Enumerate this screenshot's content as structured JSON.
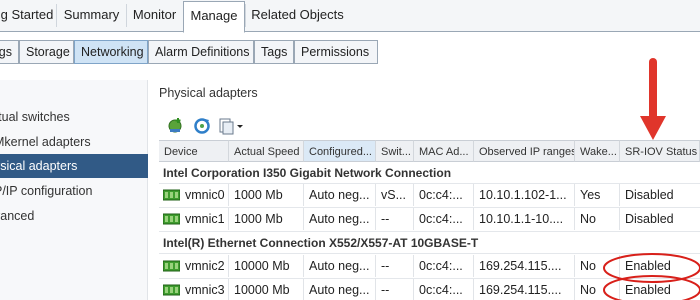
{
  "top_tabs": [
    "g Started",
    "Summary",
    "Monitor",
    "Manage",
    "Related Objects"
  ],
  "sub_tabs": [
    "ings",
    "Storage",
    "Networking",
    "Alarm Definitions",
    "Tags",
    "Permissions"
  ],
  "left_nav": [
    "rtual switches",
    "Mkernel adapters",
    "ysical adapters",
    "P/IP configuration",
    "vanced"
  ],
  "section_title": "Physical adapters",
  "toolbar": {
    "icons": [
      "add-networking-icon",
      "refresh-icon",
      "actions-menu-icon"
    ]
  },
  "grid": {
    "columns": [
      "Device",
      "Actual Speed",
      "Configured...",
      "Swit...",
      "MAC Ad...",
      "Observed IP ranges",
      "Wake...",
      "SR-IOV Status"
    ],
    "groups": [
      {
        "name": "Intel Corporation I350 Gigabit Network Connection",
        "rows": [
          [
            "vmnic0",
            "1000 Mb",
            "Auto neg...",
            "vS...",
            "0c:c4:...",
            "10.10.1.102-1...",
            "Yes",
            "Disabled"
          ],
          [
            "vmnic1",
            "1000 Mb",
            "Auto neg...",
            "--",
            "0c:c4:...",
            "10.10.1.1-10....",
            "No",
            "Disabled"
          ]
        ]
      },
      {
        "name": "Intel(R) Ethernet Connection X552/X557-AT 10GBASE-T",
        "rows": [
          [
            "vmnic2",
            "10000 Mb",
            "Auto neg...",
            "--",
            "0c:c4:...",
            "169.254.115....",
            "No",
            "Enabled"
          ],
          [
            "vmnic3",
            "10000 Mb",
            "Auto neg...",
            "--",
            "0c:c4:...",
            "169.254.115....",
            "No",
            "Enabled"
          ]
        ]
      }
    ]
  },
  "colors": {
    "accent_active_nav": "#315a86",
    "annotation_red": "#e0352b",
    "nic_icon_green": "#3f9d2e"
  }
}
